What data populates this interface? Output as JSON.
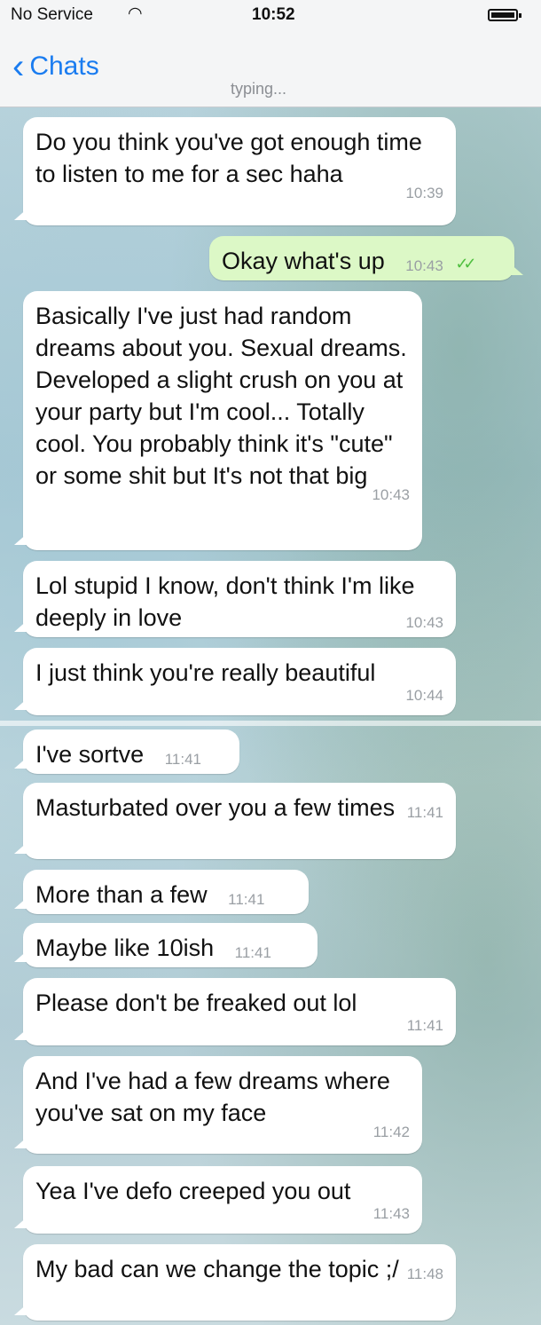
{
  "status_bar": {
    "carrier": "No Service",
    "time": "10:52"
  },
  "nav": {
    "back_label": "Chats",
    "subtitle": "typing..."
  },
  "messages": [
    {
      "text": "Do you think you've got enough time to listen to me for a sec haha",
      "time": "10:39"
    },
    {
      "text": "Okay what's up",
      "time": "10:43",
      "outgoing": true,
      "status_ticks": "✓✓"
    },
    {
      "text": "Basically I've just had random dreams about you. Sexual dreams. Developed a slight crush on you at your party but I'm cool... Totally cool. You probably think it's \"cute\" or some shit but It's not that big",
      "time": "10:43"
    },
    {
      "text": "Lol stupid I know, don't think I'm like deeply in love",
      "time": "10:43"
    },
    {
      "text": "I just think you're really beautiful",
      "time": "10:44"
    },
    {
      "text": "I've sortve",
      "time": "11:41"
    },
    {
      "text": "Masturbated over you a few times",
      "time": "11:41"
    },
    {
      "text": "More than a few",
      "time": "11:41"
    },
    {
      "text": "Maybe like 10ish",
      "time": "11:41"
    },
    {
      "text": "Please don't be freaked out lol",
      "time": "11:41"
    },
    {
      "text": "And I've had a few dreams where you've sat on my face",
      "time": "11:42"
    },
    {
      "text": "Yea I've defo creeped you out",
      "time": "11:43"
    },
    {
      "text": "My bad can we change the topic ;/",
      "time": "11:48"
    }
  ],
  "colors": {
    "accent": "#1a7cf0",
    "outgoing_bubble": "#dcf8c6",
    "read_ticks": "#4fbf3f"
  }
}
